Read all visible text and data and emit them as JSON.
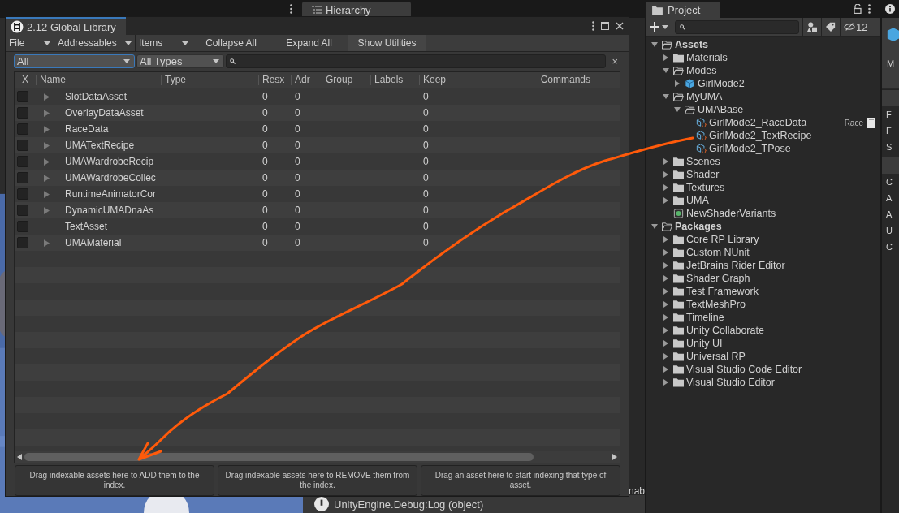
{
  "background_tab": {
    "title": "Hierarchy"
  },
  "console": {
    "message": "UnityEngine.Debug:Log (object)",
    "fragment": "nab"
  },
  "library_window": {
    "title": "2.12 Global Library",
    "menus": [
      {
        "label": "File",
        "kind": "dropdown"
      },
      {
        "label": "Addressables",
        "kind": "dropdown"
      },
      {
        "label": "Items",
        "kind": "dropdown"
      },
      {
        "label": "Collapse All",
        "kind": "button"
      },
      {
        "label": "Expand All",
        "kind": "button"
      },
      {
        "label": "Show Utilities",
        "kind": "button"
      }
    ],
    "filters": [
      {
        "value": "All",
        "focused": true
      },
      {
        "value": "All Types",
        "focused": false
      }
    ],
    "search": {
      "clear": "×"
    },
    "table": {
      "columns": [
        "X",
        "Name",
        "Type",
        "Resx",
        "Adr",
        "Group",
        "Labels",
        "Keep",
        "Commands"
      ],
      "rows": [
        {
          "name": "SlotDataAsset",
          "checked": false,
          "expandable": true,
          "resx": "0",
          "adr": "0",
          "keep": "0"
        },
        {
          "name": "OverlayDataAsset",
          "checked": false,
          "expandable": true,
          "resx": "0",
          "adr": "0",
          "keep": "0"
        },
        {
          "name": "RaceData",
          "checked": false,
          "expandable": true,
          "resx": "0",
          "adr": "0",
          "keep": "0"
        },
        {
          "name": "UMATextRecipe",
          "checked": false,
          "expandable": true,
          "resx": "0",
          "adr": "0",
          "keep": "0"
        },
        {
          "name": "UMAWardrobeRecip",
          "checked": false,
          "expandable": true,
          "resx": "0",
          "adr": "0",
          "keep": "0"
        },
        {
          "name": "UMAWardrobeCollec",
          "checked": false,
          "expandable": true,
          "resx": "0",
          "adr": "0",
          "keep": "0"
        },
        {
          "name": "RuntimeAnimatorCor",
          "checked": false,
          "expandable": true,
          "resx": "0",
          "adr": "0",
          "keep": "0"
        },
        {
          "name": "DynamicUMADnaAs",
          "checked": false,
          "expandable": true,
          "resx": "0",
          "adr": "0",
          "keep": "0"
        },
        {
          "name": "TextAsset",
          "checked": false,
          "expandable": false,
          "resx": "0",
          "adr": "0",
          "keep": "0"
        },
        {
          "name": "UMAMaterial",
          "checked": false,
          "expandable": true,
          "resx": "0",
          "adr": "0",
          "keep": "0"
        }
      ]
    },
    "drop_zones": [
      "Drag indexable assets here to ADD them to the index.",
      "Drag indexable assets here to REMOVE them from the index.",
      "Drag an asset here to start indexing that type of asset."
    ]
  },
  "project": {
    "title": "Project",
    "hidden_count": "12",
    "tree": [
      {
        "label": "Assets",
        "kind": "folder",
        "expanded": true,
        "children": [
          {
            "label": "Materials",
            "kind": "folder",
            "expanded": false
          },
          {
            "label": "Modes",
            "kind": "folder",
            "expanded": true,
            "children": [
              {
                "label": "GirlMode2",
                "kind": "prefab",
                "expanded": false
              }
            ]
          },
          {
            "label": "MyUMA",
            "kind": "folder",
            "expanded": true,
            "children": [
              {
                "label": "UMABase",
                "kind": "folder",
                "expanded": true,
                "children": [
                  {
                    "label": "GirlMode2_RaceData",
                    "kind": "asset",
                    "tag": "Race"
                  },
                  {
                    "label": "GirlMode2_TextRecipe",
                    "kind": "asset"
                  },
                  {
                    "label": "GirlMode2_TPose",
                    "kind": "asset"
                  }
                ]
              }
            ]
          },
          {
            "label": "Scenes",
            "kind": "folder",
            "expanded": false
          },
          {
            "label": "Shader",
            "kind": "folder",
            "expanded": false
          },
          {
            "label": "Textures",
            "kind": "folder",
            "expanded": false
          },
          {
            "label": "UMA",
            "kind": "folder",
            "expanded": false
          },
          {
            "label": "NewShaderVariants",
            "kind": "shader"
          }
        ]
      },
      {
        "label": "Packages",
        "kind": "folder",
        "expanded": true,
        "children": [
          {
            "label": "Core RP Library",
            "kind": "folder",
            "expanded": false
          },
          {
            "label": "Custom NUnit",
            "kind": "folder",
            "expanded": false
          },
          {
            "label": "JetBrains Rider Editor",
            "kind": "folder",
            "expanded": false
          },
          {
            "label": "Shader Graph",
            "kind": "folder",
            "expanded": false
          },
          {
            "label": "Test Framework",
            "kind": "folder",
            "expanded": false
          },
          {
            "label": "TextMeshPro",
            "kind": "folder",
            "expanded": false
          },
          {
            "label": "Timeline",
            "kind": "folder",
            "expanded": false
          },
          {
            "label": "Unity Collaborate",
            "kind": "folder",
            "expanded": false
          },
          {
            "label": "Unity UI",
            "kind": "folder",
            "expanded": false
          },
          {
            "label": "Universal RP",
            "kind": "folder",
            "expanded": false
          },
          {
            "label": "Visual Studio Code Editor",
            "kind": "folder",
            "expanded": false
          },
          {
            "label": "Visual Studio Editor",
            "kind": "folder",
            "expanded": false
          }
        ]
      }
    ]
  },
  "inspector": {
    "fragments": [
      "M",
      "F",
      "F",
      "S",
      "C",
      "A",
      "A",
      "U",
      "C"
    ]
  }
}
